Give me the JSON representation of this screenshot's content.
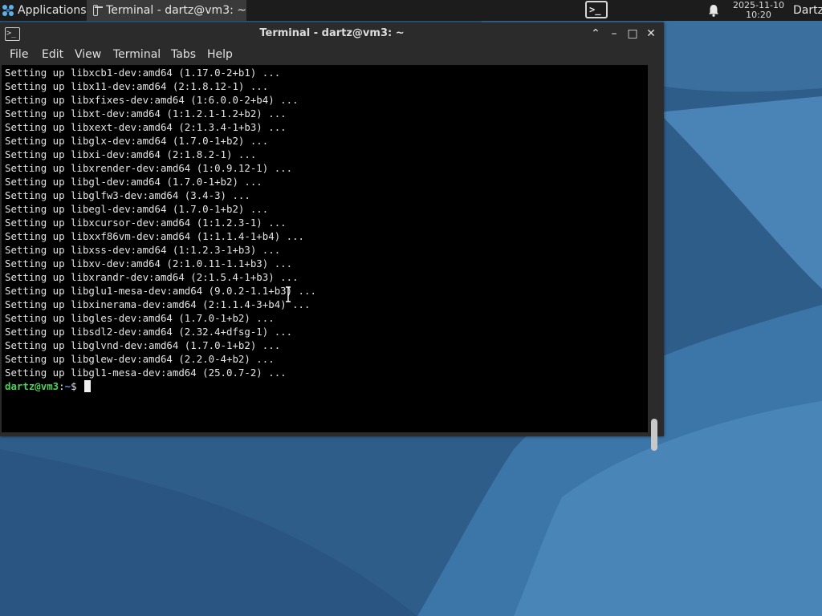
{
  "panel": {
    "applications_label": "Applications",
    "task_label": "Terminal - dartz@vm3: ~",
    "terminal_glyph": ">_",
    "clock_date": "2025-11-10",
    "clock_time": "10:20",
    "user_label": "Dartz"
  },
  "window": {
    "title": "Terminal - dartz@vm3: ~",
    "menu": [
      "File",
      "Edit",
      "View",
      "Terminal",
      "Tabs",
      "Help"
    ]
  },
  "terminal": {
    "lines": [
      "Setting up libxcb1-dev:amd64 (1.17.0-2+b1) ...",
      "Setting up libx11-dev:amd64 (2:1.8.12-1) ...",
      "Setting up libxfixes-dev:amd64 (1:6.0.0-2+b4) ...",
      "Setting up libxt-dev:amd64 (1:1.2.1-1.2+b2) ...",
      "Setting up libxext-dev:amd64 (2:1.3.4-1+b3) ...",
      "Setting up libglx-dev:amd64 (1.7.0-1+b2) ...",
      "Setting up libxi-dev:amd64 (2:1.8.2-1) ...",
      "Setting up libxrender-dev:amd64 (1:0.9.12-1) ...",
      "Setting up libgl-dev:amd64 (1.7.0-1+b2) ...",
      "Setting up libglfw3-dev:amd64 (3.4-3) ...",
      "Setting up libegl-dev:amd64 (1.7.0-1+b2) ...",
      "Setting up libxcursor-dev:amd64 (1:1.2.3-1) ...",
      "Setting up libxxf86vm-dev:amd64 (1:1.1.4-1+b4) ...",
      "Setting up libxss-dev:amd64 (1:1.2.3-1+b3) ...",
      "Setting up libxv-dev:amd64 (2:1.0.11-1.1+b3) ...",
      "Setting up libxrandr-dev:amd64 (2:1.5.4-1+b3) ...",
      "Setting up libglu1-mesa-dev:amd64 (9.0.2-1.1+b3) ...",
      "Setting up libxinerama-dev:amd64 (2:1.1.4-3+b4) ...",
      "Setting up libgles-dev:amd64 (1.7.0-1+b2) ...",
      "Setting up libsdl2-dev:amd64 (2.32.4+dfsg-1) ...",
      "Setting up libglvnd-dev:amd64 (1.7.0-1+b2) ...",
      "Setting up libglew-dev:amd64 (2.2.0-4+b2) ...",
      "Setting up libgl1-mesa-dev:amd64 (25.0.7-2) ..."
    ],
    "prompt_user": "dartz@vm3",
    "prompt_sep": ":",
    "prompt_path": "~",
    "prompt_symbol": "$"
  },
  "colors": {
    "prompt_user": "#4fd15a",
    "prompt_path": "#5e8fe0",
    "terminal_bg": "#000000",
    "window_chrome": "#2b2b2b"
  }
}
